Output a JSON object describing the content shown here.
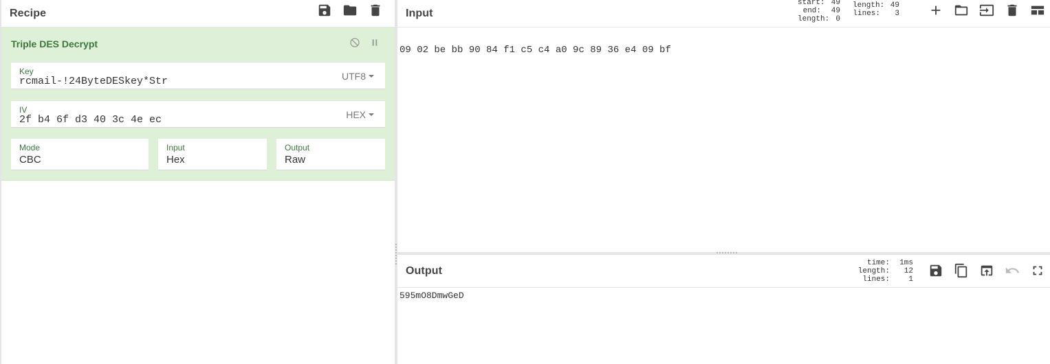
{
  "recipe": {
    "title": "Recipe",
    "icons": [
      "save-icon",
      "folder-icon",
      "trash-icon"
    ],
    "operation": {
      "title": "Triple DES Decrypt",
      "key": {
        "label": "Key",
        "value": "rcmail-!24ByteDESkey*Str",
        "encoding": "UTF8"
      },
      "iv": {
        "label": "IV",
        "value": "2f b4 6f d3 40 3c 4e ec",
        "encoding": "HEX"
      },
      "mode": {
        "label": "Mode",
        "value": "CBC"
      },
      "input": {
        "label": "Input",
        "value": "Hex"
      },
      "output": {
        "label": "Output",
        "value": "Raw"
      }
    }
  },
  "input": {
    "title": "Input",
    "stats": {
      "start_label": "start:",
      "start": "49",
      "end_label": "end:",
      "end": "49",
      "sel_length_label": "length:",
      "sel_length": "0",
      "length_label": "length:",
      "length": "49",
      "lines_label": "lines:",
      "lines": "3"
    },
    "text": "09 02 be bb 90 84 f1 c5 c4 a0 9c 89 36 e4 09 bf"
  },
  "output": {
    "title": "Output",
    "stats": {
      "time_label": "time:",
      "time": "1ms",
      "length_label": "length:",
      "length": "12",
      "lines_label": "lines:",
      "lines": "1"
    },
    "text": "595mO8DmwGeD"
  }
}
